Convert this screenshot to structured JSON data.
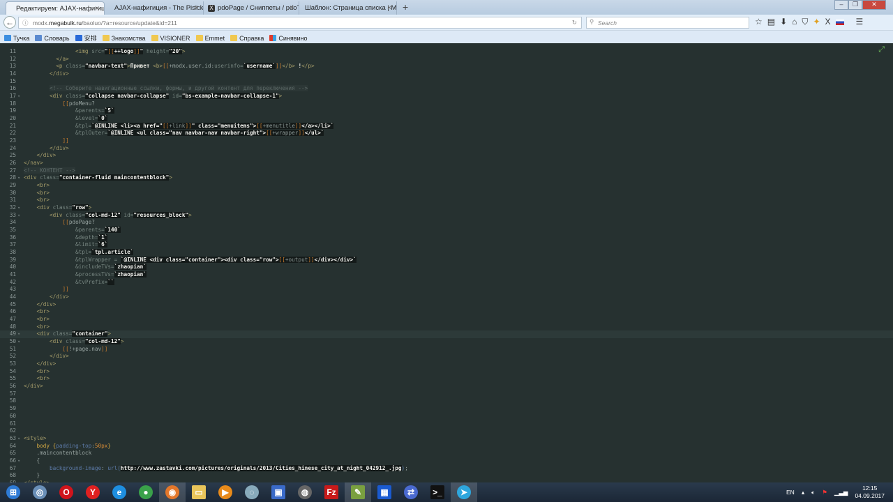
{
  "browser": {
    "tabs": [
      {
        "label": "Редактируем: AJAX-нафигиция |",
        "active": true
      },
      {
        "label": "AJAX-нафигиция - The Pisicks",
        "active": false
      },
      {
        "label": "pdoPage / Сниппеты / pdoT",
        "active": false,
        "favicon": "X"
      },
      {
        "label": "Шаблон: Страница списка | MO",
        "active": false
      }
    ],
    "new_tab": "+",
    "url_prefix": "modx.",
    "url_domain": "megabulk.ru",
    "url_path": "/baoluo/?a=resource/update&id=211",
    "search_placeholder": "Search",
    "bookmarks": [
      "Тучка",
      "Словарь",
      "安排",
      "Знакомства",
      "VISIONER",
      "Emmet",
      "Справка",
      "Синявино"
    ]
  },
  "code": {
    "current_line": 49,
    "lines": [
      {
        "n": 11,
        "t": [
          [
            "t",
            "                <img "
          ],
          [
            "a",
            "src="
          ],
          [
            "s",
            "\""
          ],
          [
            "bs",
            "[["
          ],
          [
            "s",
            "++logo"
          ],
          [
            "bs",
            "]]"
          ],
          [
            "s",
            "\""
          ],
          [
            "a",
            " height="
          ],
          [
            "s",
            "\"20\""
          ],
          [
            "t",
            ">"
          ]
        ]
      },
      {
        "n": 12,
        "t": [
          [
            "t",
            "          </a>"
          ]
        ]
      },
      {
        "n": 13,
        "t": [
          [
            "t",
            "          <p "
          ],
          [
            "a",
            "class="
          ],
          [
            "s",
            "\"navbar-text\""
          ],
          [
            "t",
            ">"
          ],
          [
            "w",
            "Привет "
          ],
          [
            "t",
            "<b>"
          ],
          [
            "b",
            "[["
          ],
          [
            "p",
            "+modx.user.id:"
          ],
          [
            "a",
            "userinfo="
          ],
          [
            "s",
            "`username`"
          ],
          [
            "b",
            "]]"
          ],
          [
            "t",
            "</b>"
          ],
          [
            "w",
            " !"
          ],
          [
            "t",
            "</p>"
          ]
        ]
      },
      {
        "n": 14,
        "t": [
          [
            "t",
            "        </div>"
          ]
        ]
      },
      {
        "n": 15,
        "t": []
      },
      {
        "n": 16,
        "t": [
          [
            "p",
            "        "
          ],
          [
            "c",
            "<!-- Соберите навигационные ссылки, формы, и другой контент для переключения -->"
          ]
        ]
      },
      {
        "n": 17,
        "fold": true,
        "t": [
          [
            "t",
            "        <div "
          ],
          [
            "a",
            "class="
          ],
          [
            "s",
            "\"collapse navbar-collapse\""
          ],
          [
            "a",
            " id="
          ],
          [
            "s",
            "\"bs-example-navbar-collapse-1\""
          ],
          [
            "t",
            ">"
          ]
        ]
      },
      {
        "n": 18,
        "t": [
          [
            "p",
            "            "
          ],
          [
            "b",
            "[["
          ],
          [
            "p",
            "pdoMenu?"
          ]
        ]
      },
      {
        "n": 19,
        "t": [
          [
            "a",
            "                &parents="
          ],
          [
            "s",
            "`5`"
          ]
        ]
      },
      {
        "n": 20,
        "t": [
          [
            "a",
            "                &level="
          ],
          [
            "s",
            "`0`"
          ]
        ]
      },
      {
        "n": 21,
        "t": [
          [
            "a",
            "                &tpl="
          ],
          [
            "s",
            "`@INLINE <li><a href=\""
          ],
          [
            "bs",
            "[["
          ],
          [
            "sd",
            "+link"
          ],
          [
            "bs",
            "]]"
          ],
          [
            "s",
            "\" class=\"menuitems\">"
          ],
          [
            "bs",
            "[["
          ],
          [
            "sd",
            "+menutitle"
          ],
          [
            "bs",
            "]]"
          ],
          [
            "s",
            "</a></li>`"
          ]
        ]
      },
      {
        "n": 22,
        "t": [
          [
            "a",
            "                &tplOuter="
          ],
          [
            "s",
            "`@INLINE <ul class=\"nav navbar-nav navbar-right\">"
          ],
          [
            "bs",
            "[["
          ],
          [
            "sd",
            "+wrapper"
          ],
          [
            "bs",
            "]]"
          ],
          [
            "s",
            "</ul>`"
          ]
        ]
      },
      {
        "n": 23,
        "t": [
          [
            "b",
            "            ]]"
          ]
        ]
      },
      {
        "n": 24,
        "t": [
          [
            "t",
            "        </div>"
          ]
        ]
      },
      {
        "n": 25,
        "t": [
          [
            "t",
            "    </div>"
          ]
        ]
      },
      {
        "n": 26,
        "t": [
          [
            "t",
            "</nav>"
          ]
        ]
      },
      {
        "n": 27,
        "t": [
          [
            "c",
            "<!-- КОНТЕНТ -->"
          ]
        ]
      },
      {
        "n": 28,
        "fold": true,
        "t": [
          [
            "t",
            "<div "
          ],
          [
            "a",
            "class="
          ],
          [
            "s",
            "\"container-fluid maincontentblock\""
          ],
          [
            "t",
            ">"
          ]
        ]
      },
      {
        "n": 29,
        "t": [
          [
            "t",
            "    <br>"
          ]
        ]
      },
      {
        "n": 30,
        "t": [
          [
            "t",
            "    <br>"
          ]
        ]
      },
      {
        "n": 31,
        "t": [
          [
            "t",
            "    <br>"
          ]
        ]
      },
      {
        "n": 32,
        "fold": true,
        "t": [
          [
            "t",
            "    <div "
          ],
          [
            "a",
            "class="
          ],
          [
            "s",
            "\"row\""
          ],
          [
            "t",
            ">"
          ]
        ]
      },
      {
        "n": 33,
        "fold": true,
        "t": [
          [
            "t",
            "        <div "
          ],
          [
            "a",
            "class="
          ],
          [
            "s",
            "\"col-md-12\""
          ],
          [
            "a",
            " id="
          ],
          [
            "s",
            "\"resources_block\""
          ],
          [
            "t",
            ">"
          ]
        ]
      },
      {
        "n": 34,
        "t": [
          [
            "p",
            "            "
          ],
          [
            "b",
            "[["
          ],
          [
            "p",
            "pdoPage?"
          ]
        ]
      },
      {
        "n": 35,
        "t": [
          [
            "a",
            "                &parents="
          ],
          [
            "s",
            "`140`"
          ]
        ]
      },
      {
        "n": 36,
        "t": [
          [
            "a",
            "                &depth="
          ],
          [
            "s",
            "`1`"
          ]
        ]
      },
      {
        "n": 37,
        "t": [
          [
            "a",
            "                &limit="
          ],
          [
            "s",
            "`6`"
          ]
        ]
      },
      {
        "n": 38,
        "t": [
          [
            "a",
            "                &tpl="
          ],
          [
            "s",
            "`tpl.article`"
          ]
        ]
      },
      {
        "n": 39,
        "t": [
          [
            "a",
            "                &tplWrapper = "
          ],
          [
            "s",
            "`@INLINE <div class=\"container\"><div class=\"row\">"
          ],
          [
            "bs",
            "[["
          ],
          [
            "sd",
            "+output"
          ],
          [
            "bs",
            "]]"
          ],
          [
            "s",
            "</div></div>`"
          ]
        ]
      },
      {
        "n": 40,
        "t": [
          [
            "a",
            "                &includeTVs="
          ],
          [
            "s",
            "`zhaopian`"
          ]
        ]
      },
      {
        "n": 41,
        "t": [
          [
            "a",
            "                &processTVs="
          ],
          [
            "s",
            "`zhaopian`"
          ]
        ]
      },
      {
        "n": 42,
        "t": [
          [
            "a",
            "                &tvPrefix="
          ],
          [
            "s",
            "``"
          ]
        ]
      },
      {
        "n": 43,
        "t": [
          [
            "b",
            "            ]]"
          ]
        ]
      },
      {
        "n": 44,
        "t": [
          [
            "t",
            "        </div>"
          ]
        ]
      },
      {
        "n": 45,
        "t": [
          [
            "t",
            "    </div>"
          ]
        ]
      },
      {
        "n": 46,
        "t": [
          [
            "t",
            "    <br>"
          ]
        ]
      },
      {
        "n": 47,
        "t": [
          [
            "t",
            "    <br>"
          ]
        ]
      },
      {
        "n": 48,
        "t": [
          [
            "t",
            "    <br>"
          ]
        ]
      },
      {
        "n": 49,
        "fold": true,
        "t": [
          [
            "t",
            "    <div "
          ],
          [
            "a",
            "class="
          ],
          [
            "s",
            "\"container\""
          ],
          [
            "t",
            ">"
          ]
        ]
      },
      {
        "n": 50,
        "fold": true,
        "t": [
          [
            "t",
            "        <div "
          ],
          [
            "a",
            "class="
          ],
          [
            "s",
            "\"col-md-12\""
          ],
          [
            "t",
            ">"
          ]
        ]
      },
      {
        "n": 51,
        "t": [
          [
            "p",
            "            "
          ],
          [
            "b",
            "[["
          ],
          [
            "p",
            "!+page.nav"
          ],
          [
            "b",
            "]]"
          ]
        ]
      },
      {
        "n": 52,
        "t": [
          [
            "t",
            "        </div>"
          ]
        ]
      },
      {
        "n": 53,
        "t": [
          [
            "t",
            "    </div>"
          ]
        ]
      },
      {
        "n": 54,
        "t": [
          [
            "t",
            "    <br>"
          ]
        ]
      },
      {
        "n": 55,
        "t": [
          [
            "t",
            "    <br>"
          ]
        ]
      },
      {
        "n": 56,
        "t": [
          [
            "t",
            "</div>"
          ]
        ]
      },
      {
        "n": 57,
        "t": []
      },
      {
        "n": 58,
        "t": []
      },
      {
        "n": 59,
        "t": []
      },
      {
        "n": 60,
        "t": []
      },
      {
        "n": 61,
        "t": []
      },
      {
        "n": 62,
        "t": []
      },
      {
        "n": 63,
        "fold": true,
        "t": [
          [
            "t",
            "<style>"
          ]
        ]
      },
      {
        "n": 64,
        "t": [
          [
            "k",
            "    body "
          ],
          [
            "k",
            "{"
          ],
          [
            "cp",
            "padding-top"
          ],
          [
            "p",
            ":"
          ],
          [
            "n",
            "50px"
          ],
          [
            "k",
            "}"
          ]
        ]
      },
      {
        "n": 65,
        "t": [
          [
            "p",
            "    .maincontentblock"
          ]
        ]
      },
      {
        "n": 66,
        "fold": true,
        "t": [
          [
            "p",
            "    {"
          ]
        ]
      },
      {
        "n": 67,
        "t": [
          [
            "cp",
            "        background-image"
          ],
          [
            "p",
            ": "
          ],
          [
            "cp",
            "url("
          ],
          [
            "s",
            "http://www.zastavki.com/pictures/originals/2013/Cities_hinese_city_at_night_042912_.jpg"
          ],
          [
            "cp",
            ")"
          ],
          [
            "p",
            ";"
          ]
        ]
      },
      {
        "n": 68,
        "t": [
          [
            "p",
            "    }"
          ]
        ]
      },
      {
        "n": 69,
        "t": [
          [
            "t",
            "</style>"
          ]
        ]
      }
    ]
  },
  "taskbar": {
    "apps": [
      {
        "name": "start",
        "glyph": "⊞",
        "color": "#2e7bd6"
      },
      {
        "name": "safari",
        "glyph": "◎",
        "color": "#6a8fb8"
      },
      {
        "name": "opera",
        "glyph": "O",
        "color": "#d0141c"
      },
      {
        "name": "yandex-browser",
        "glyph": "Y",
        "color": "#e02020"
      },
      {
        "name": "internet-explorer",
        "glyph": "e",
        "color": "#1e8ee0"
      },
      {
        "name": "chrome",
        "glyph": "●",
        "color": "#3aa14a"
      },
      {
        "name": "firefox",
        "glyph": "◉",
        "color": "#e4772a",
        "active": true
      },
      {
        "name": "file-explorer",
        "glyph": "▭",
        "color": "#e8c45a"
      },
      {
        "name": "media-player",
        "glyph": "▶",
        "color": "#e88a1a"
      },
      {
        "name": "disc-app",
        "glyph": "◌",
        "color": "#8ab"
      },
      {
        "name": "network-app",
        "glyph": "▣",
        "color": "#3a6ac8"
      },
      {
        "name": "github",
        "glyph": "◍",
        "color": "#666"
      },
      {
        "name": "filezilla",
        "glyph": "Fz",
        "color": "#c81a1a"
      },
      {
        "name": "notepad-plus",
        "glyph": "✎",
        "color": "#7aa040",
        "active": true
      },
      {
        "name": "calculator",
        "glyph": "▦",
        "color": "#1a5ad0"
      },
      {
        "name": "remote-connection",
        "glyph": "⇄",
        "color": "#4a6ad0"
      },
      {
        "name": "command-prompt",
        "glyph": ">_",
        "color": "#111"
      },
      {
        "name": "telegram",
        "glyph": "➤",
        "color": "#2ea6dd",
        "active": true
      }
    ],
    "language": "EN",
    "time": "12:15",
    "date": "04.09.2017"
  }
}
